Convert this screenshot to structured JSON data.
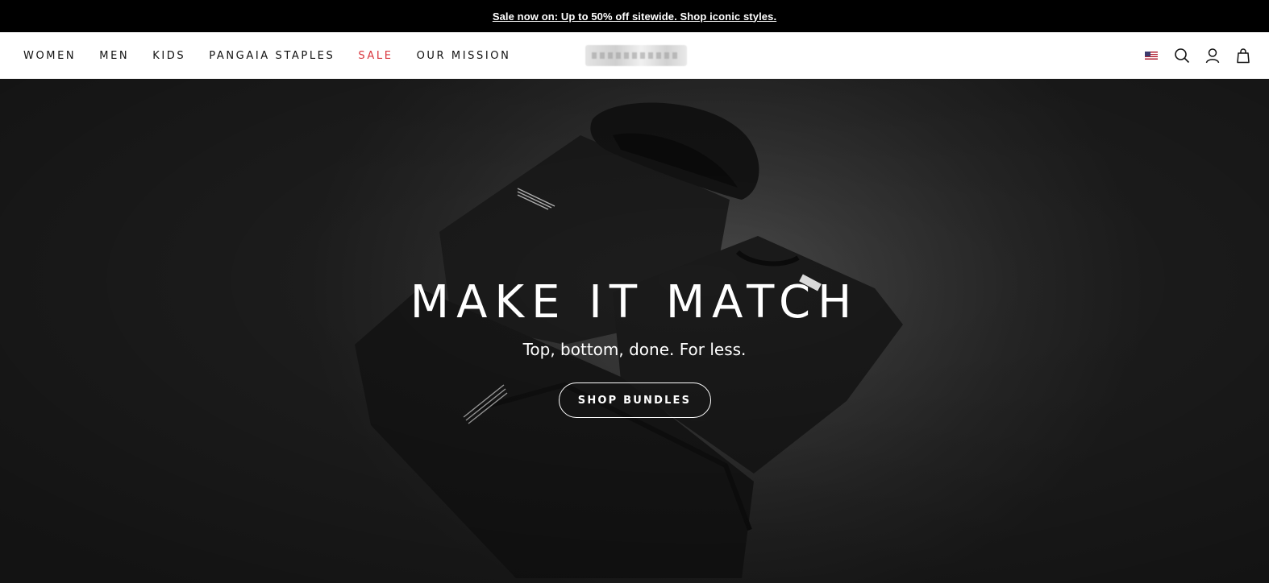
{
  "announcement": {
    "text": "Sale now on: Up to 50% off sitewide. Shop iconic styles."
  },
  "nav": {
    "items": [
      {
        "label": "WOMEN"
      },
      {
        "label": "MEN"
      },
      {
        "label": "KIDS"
      },
      {
        "label": "PANGAIA STAPLES"
      },
      {
        "label": "SALE"
      },
      {
        "label": "OUR MISSION"
      }
    ],
    "sale_color": "#d9363e"
  },
  "header_icons": [
    "us-flag-icon",
    "search-icon",
    "account-icon",
    "bag-icon"
  ],
  "hero": {
    "title": "MAKE IT MATCH",
    "subtitle": "Top, bottom, done. For less.",
    "cta_label": "SHOP BUNDLES"
  },
  "colors": {
    "announcement_bg": "#000000",
    "hero_bg": "#2b2b2b",
    "text_dark": "#111111"
  }
}
